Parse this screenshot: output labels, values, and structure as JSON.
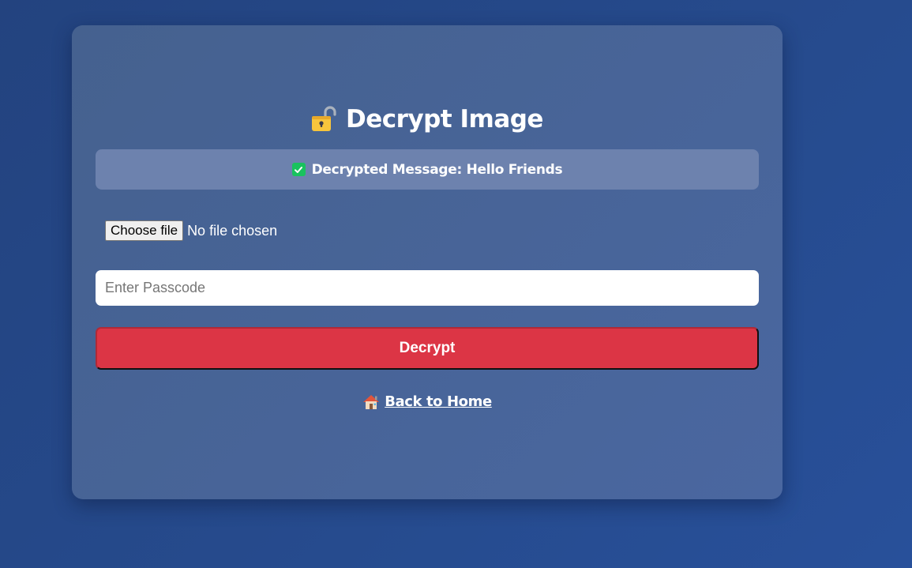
{
  "page": {
    "title": "Decrypt Image",
    "title_icon": "unlocked-padlock-icon"
  },
  "status": {
    "icon": "check-mark-icon",
    "message": "Decrypted Message: Hello Friends",
    "accent_color": "#19c25e"
  },
  "file_input": {
    "button_label": "Choose file",
    "status_text": "No file chosen"
  },
  "passcode": {
    "placeholder": "Enter Passcode",
    "value": ""
  },
  "decrypt_button": {
    "label": "Decrypt",
    "color": "#dc3545"
  },
  "back_link": {
    "icon": "house-icon",
    "label": "Back to Home"
  }
}
